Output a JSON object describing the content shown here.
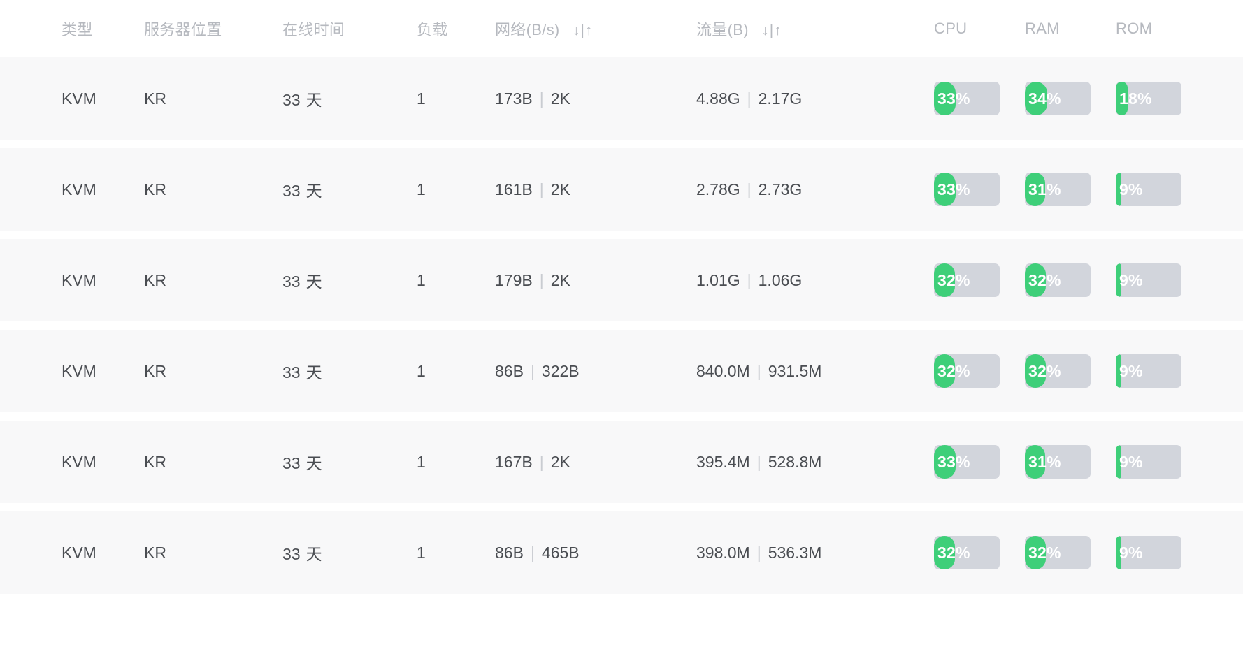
{
  "table": {
    "columns": [
      {
        "key": "type",
        "label": "类型",
        "sortable": false
      },
      {
        "key": "location",
        "label": "服务器位置",
        "sortable": false
      },
      {
        "key": "uptime",
        "label": "在线时间",
        "sortable": false
      },
      {
        "key": "load",
        "label": "负载",
        "sortable": false
      },
      {
        "key": "network",
        "label": "网络(B/s)",
        "sortable": true,
        "sort_icons": "↓|↑"
      },
      {
        "key": "traffic",
        "label": "流量(B)",
        "sortable": true,
        "sort_icons": "↓|↑"
      },
      {
        "key": "cpu",
        "label": "CPU",
        "sortable": false
      },
      {
        "key": "ram",
        "label": "RAM",
        "sortable": false
      },
      {
        "key": "rom",
        "label": "ROM",
        "sortable": false
      }
    ],
    "separator": "|",
    "uptime_unit": "天",
    "percent_suffix": "%",
    "rows": [
      {
        "type": "KVM",
        "location": "KR",
        "uptime_value": "33",
        "load": "1",
        "net_down": "173B",
        "net_up": "2K",
        "traffic_down": "4.88G",
        "traffic_up": "2.17G",
        "cpu": 33,
        "cpu_label": "33%",
        "ram": 34,
        "ram_label": "34%",
        "rom": 18,
        "rom_label": "18%"
      },
      {
        "type": "KVM",
        "location": "KR",
        "uptime_value": "33",
        "load": "1",
        "net_down": "161B",
        "net_up": "2K",
        "traffic_down": "2.78G",
        "traffic_up": "2.73G",
        "cpu": 33,
        "cpu_label": "33%",
        "ram": 31,
        "ram_label": "31%",
        "rom": 9,
        "rom_label": "9%"
      },
      {
        "type": "KVM",
        "location": "KR",
        "uptime_value": "33",
        "load": "1",
        "net_down": "179B",
        "net_up": "2K",
        "traffic_down": "1.01G",
        "traffic_up": "1.06G",
        "cpu": 32,
        "cpu_label": "32%",
        "ram": 32,
        "ram_label": "32%",
        "rom": 9,
        "rom_label": "9%"
      },
      {
        "type": "KVM",
        "location": "KR",
        "uptime_value": "33",
        "load": "1",
        "net_down": "86B",
        "net_up": "322B",
        "traffic_down": "840.0M",
        "traffic_up": "931.5M",
        "cpu": 32,
        "cpu_label": "32%",
        "ram": 32,
        "ram_label": "32%",
        "rom": 9,
        "rom_label": "9%"
      },
      {
        "type": "KVM",
        "location": "KR",
        "uptime_value": "33",
        "load": "1",
        "net_down": "167B",
        "net_up": "2K",
        "traffic_down": "395.4M",
        "traffic_up": "528.8M",
        "cpu": 33,
        "cpu_label": "33%",
        "ram": 31,
        "ram_label": "31%",
        "rom": 9,
        "rom_label": "9%"
      },
      {
        "type": "KVM",
        "location": "KR",
        "uptime_value": "33",
        "load": "1",
        "net_down": "86B",
        "net_up": "465B",
        "traffic_down": "398.0M",
        "traffic_up": "536.3M",
        "cpu": 32,
        "cpu_label": "32%",
        "ram": 32,
        "ram_label": "32%",
        "rom": 9,
        "rom_label": "9%"
      }
    ]
  },
  "colors": {
    "accent_green": "#3ecf79",
    "bar_track": "#d2d5dc",
    "row_background": "#f8f8f9",
    "page_background": "#ffffff",
    "header_text": "#b6b9bf",
    "body_text": "#4a4d52"
  }
}
